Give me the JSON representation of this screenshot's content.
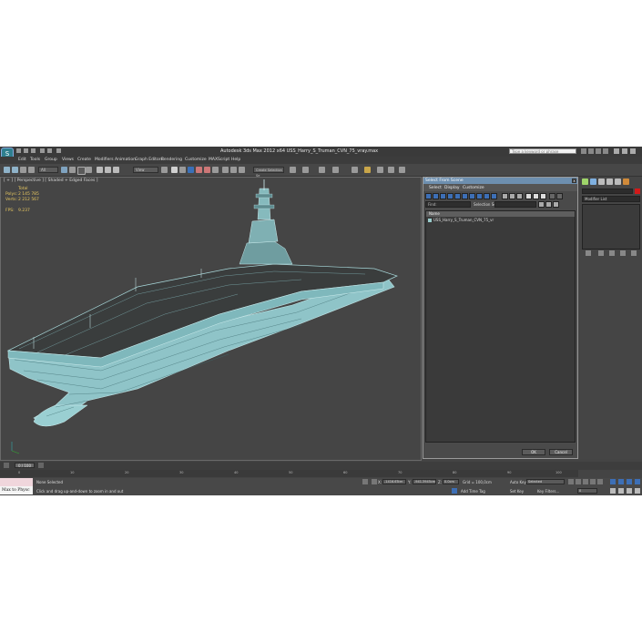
{
  "window": {
    "title": "Autodesk 3ds Max  2012 x64     USS_Harry_S_Truman_CVN_75_vray.max",
    "search_placeholder": "Type a keyword or phrase"
  },
  "menu": [
    "Edit",
    "Tools",
    "Group",
    "Views",
    "Create",
    "Modifiers",
    "Animation",
    "Graph Editors",
    "Rendering",
    "Customize",
    "MAXScript",
    "Help"
  ],
  "toolbar": {
    "filter_value": "All",
    "reference_value": "View",
    "selection_set_placeholder": "Create Selection Se"
  },
  "viewport": {
    "label": "[ + ] [ Perspective ] [ Shaded + Edged Faces ]",
    "stats": {
      "total_label": "Total",
      "polys_label": "Polys:",
      "polys_value": "2 145 785",
      "verts_label": "Verts:",
      "verts_value": "2 212 567",
      "fps_label": "FPS:",
      "fps_value": "9.237"
    }
  },
  "dialog": {
    "title": "Select From Scene",
    "close": "x",
    "menu": [
      "Select",
      "Display",
      "Customize"
    ],
    "find_label": "Find:",
    "selection_set_label": "Selection Set:",
    "list_header": "Name",
    "items": [
      "USS_Harry_S_Truman_CVN_75_vr"
    ],
    "ok_label": "OK",
    "cancel_label": "Cancel"
  },
  "command_panel": {
    "modifier_list": "Modifier List",
    "color_swatch": "#d11a1a"
  },
  "timeline": {
    "slider": "0 / 100",
    "ticks": [
      "0",
      "10",
      "20",
      "30",
      "40",
      "50",
      "60",
      "70",
      "80",
      "90",
      "100"
    ]
  },
  "status": {
    "maxscript_label": "Max to Physc",
    "selected": "None Selected",
    "prompt": "Click and drag up-and-down to zoom in and out",
    "x_label": "X:",
    "x_value": "-1416.6Tcm",
    "y_label": "Y:",
    "y_value": "-941.3945cm",
    "z_label": "Z:",
    "z_value": "0.0cm",
    "grid": "Grid = 100,0cm",
    "autokey": "Auto Key",
    "autokey_value": "Selected",
    "setkey": "Set Key",
    "key_filters": "Key Filters...",
    "add_time_tag": "Add Time Tag",
    "frame_value": "0"
  }
}
